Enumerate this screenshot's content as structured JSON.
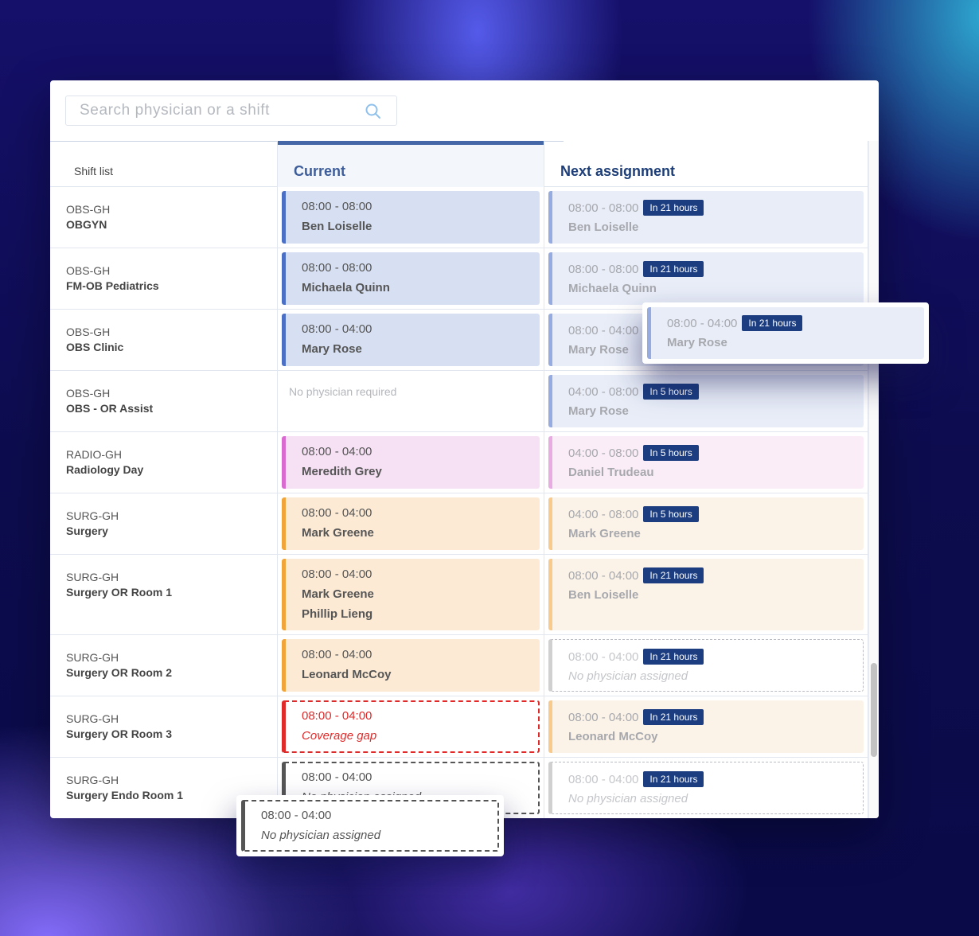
{
  "search": {
    "placeholder": "Search physician or a shift",
    "value": "",
    "icon": "search-icon"
  },
  "columns": {
    "shift_list": "Shift list",
    "current": "Current",
    "next": "Next assignment"
  },
  "colors": {
    "accent": "#1c3e80",
    "header_bar": "#4467a8",
    "obs": "#4a6fc4",
    "radiology": "#d86ad0",
    "surgery": "#f0a43a",
    "gap": "#e02a2a"
  },
  "rows": [
    {
      "code": "OBS-GH",
      "name": "OBGYN",
      "current": {
        "time": "08:00 - 08:00",
        "names": [
          "Ben Loiselle"
        ]
      },
      "next": {
        "time": "08:00 - 08:00",
        "badge": "In 21 hours",
        "names": [
          "Ben Loiselle"
        ]
      }
    },
    {
      "code": "OBS-GH",
      "name": "FM-OB Pediatrics",
      "current": {
        "time": "08:00 - 08:00",
        "names": [
          "Michaela Quinn"
        ]
      },
      "next": {
        "time": "08:00 - 08:00",
        "badge": "In 21 hours",
        "names": [
          "Michaela Quinn"
        ]
      }
    },
    {
      "code": "OBS-GH",
      "name": "OBS Clinic",
      "current": {
        "time": "08:00 - 04:00",
        "names": [
          "Mary Rose"
        ]
      },
      "next": {
        "time": "08:00 - 04:00",
        "badge": "In 21 hours",
        "names": [
          "Mary Rose"
        ]
      }
    },
    {
      "code": "OBS-GH",
      "name": "OBS - OR Assist",
      "current": {
        "note": "No physician required"
      },
      "next": {
        "time": "04:00 - 08:00",
        "badge": "In 5 hours",
        "names": [
          "Mary Rose"
        ]
      }
    },
    {
      "code": "RADIO-GH",
      "name": "Radiology Day",
      "current": {
        "time": "08:00 - 04:00",
        "names": [
          "Meredith Grey"
        ]
      },
      "next": {
        "time": "04:00 - 08:00",
        "badge": "In 5 hours",
        "names": [
          "Daniel Trudeau"
        ]
      }
    },
    {
      "code": "SURG-GH",
      "name": "Surgery",
      "current": {
        "time": "08:00 - 04:00",
        "names": [
          "Mark Greene"
        ]
      },
      "next": {
        "time": "04:00 - 08:00",
        "badge": "In 5 hours",
        "names": [
          "Mark Greene"
        ]
      }
    },
    {
      "code": "SURG-GH",
      "name": "Surgery OR Room 1",
      "current": {
        "time": "08:00 - 04:00",
        "names": [
          "Mark Greene",
          "Phillip Lieng"
        ]
      },
      "next": {
        "time": "08:00 - 04:00",
        "badge": "In 21 hours",
        "names": [
          "Ben Loiselle"
        ]
      }
    },
    {
      "code": "SURG-GH",
      "name": "Surgery OR Room 2",
      "current": {
        "time": "08:00 - 04:00",
        "names": [
          "Leonard McCoy"
        ]
      },
      "next": {
        "time": "08:00 - 04:00",
        "badge": "In 21 hours",
        "names": [
          "No physician assigned"
        ]
      }
    },
    {
      "code": "SURG-GH",
      "name": "Surgery OR Room 3",
      "current": {
        "time": "08:00 - 04:00",
        "names": [
          "Coverage gap"
        ]
      },
      "next": {
        "time": "08:00 - 04:00",
        "badge": "In 21 hours",
        "names": [
          "Leonard McCoy"
        ]
      }
    },
    {
      "code": "SURG-GH",
      "name": "Surgery Endo Room 1",
      "current": {
        "time": "08:00 - 04:00",
        "names": [
          "No physician assigned"
        ]
      },
      "next": {
        "time": "08:00 - 04:00",
        "badge": "In 21 hours",
        "names": [
          "No physician assigned"
        ]
      }
    }
  ],
  "dragged_cards": [
    {
      "time": "08:00 - 04:00",
      "badge": "In 21 hours",
      "name": "Mary Rose"
    },
    {
      "time": "08:00 - 04:00",
      "name": "No physician assigned"
    }
  ]
}
